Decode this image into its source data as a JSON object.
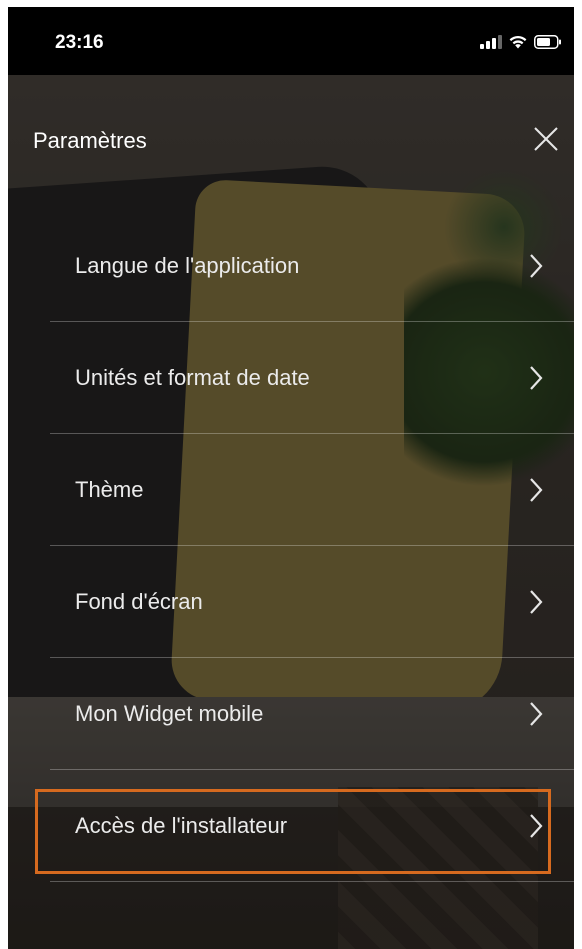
{
  "status_bar": {
    "time": "23:16",
    "icons": [
      "cellular-signal-icon",
      "wifi-icon",
      "battery-icon"
    ]
  },
  "header": {
    "title": "Paramètres",
    "close_icon": "close-icon"
  },
  "menu": {
    "items": [
      {
        "label": "Langue de l'application",
        "icon": "chevron-right-icon"
      },
      {
        "label": "Unités et format de date",
        "icon": "chevron-right-icon"
      },
      {
        "label": "Thème",
        "icon": "chevron-right-icon"
      },
      {
        "label": "Fond d'écran",
        "icon": "chevron-right-icon"
      },
      {
        "label": "Mon Widget mobile",
        "icon": "chevron-right-icon"
      },
      {
        "label": "Accès de l'installateur",
        "icon": "chevron-right-icon",
        "highlighted": true
      }
    ]
  },
  "colors": {
    "highlight": "#d66a1f",
    "text": "#ebebeb",
    "status_bar_bg": "#000000"
  }
}
